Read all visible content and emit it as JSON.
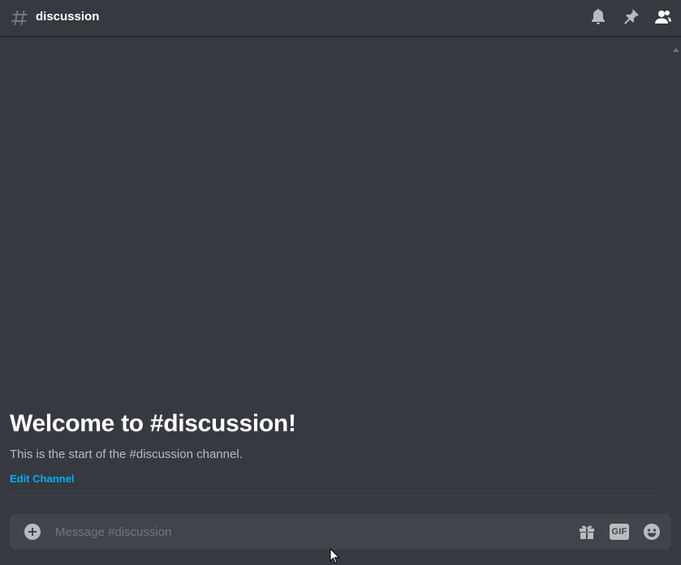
{
  "header": {
    "channel_name": "discussion",
    "icons": [
      "notification-bell-icon",
      "pin-icon",
      "member-list-icon"
    ]
  },
  "welcome": {
    "title": "Welcome to #discussion!",
    "subtitle": "This is the start of the #discussion channel.",
    "edit_link": "Edit Channel"
  },
  "composer": {
    "placeholder": "Message #discussion",
    "value": "",
    "gif_label": "GIF",
    "buttons": [
      "upload-plus-icon",
      "gift-icon",
      "gif-icon",
      "emoji-icon"
    ]
  },
  "colors": {
    "background": "#36393f",
    "composer_bg": "#40444b",
    "link": "#00aff4",
    "icon": "#b9bbbe",
    "muted_text": "#72767d"
  }
}
